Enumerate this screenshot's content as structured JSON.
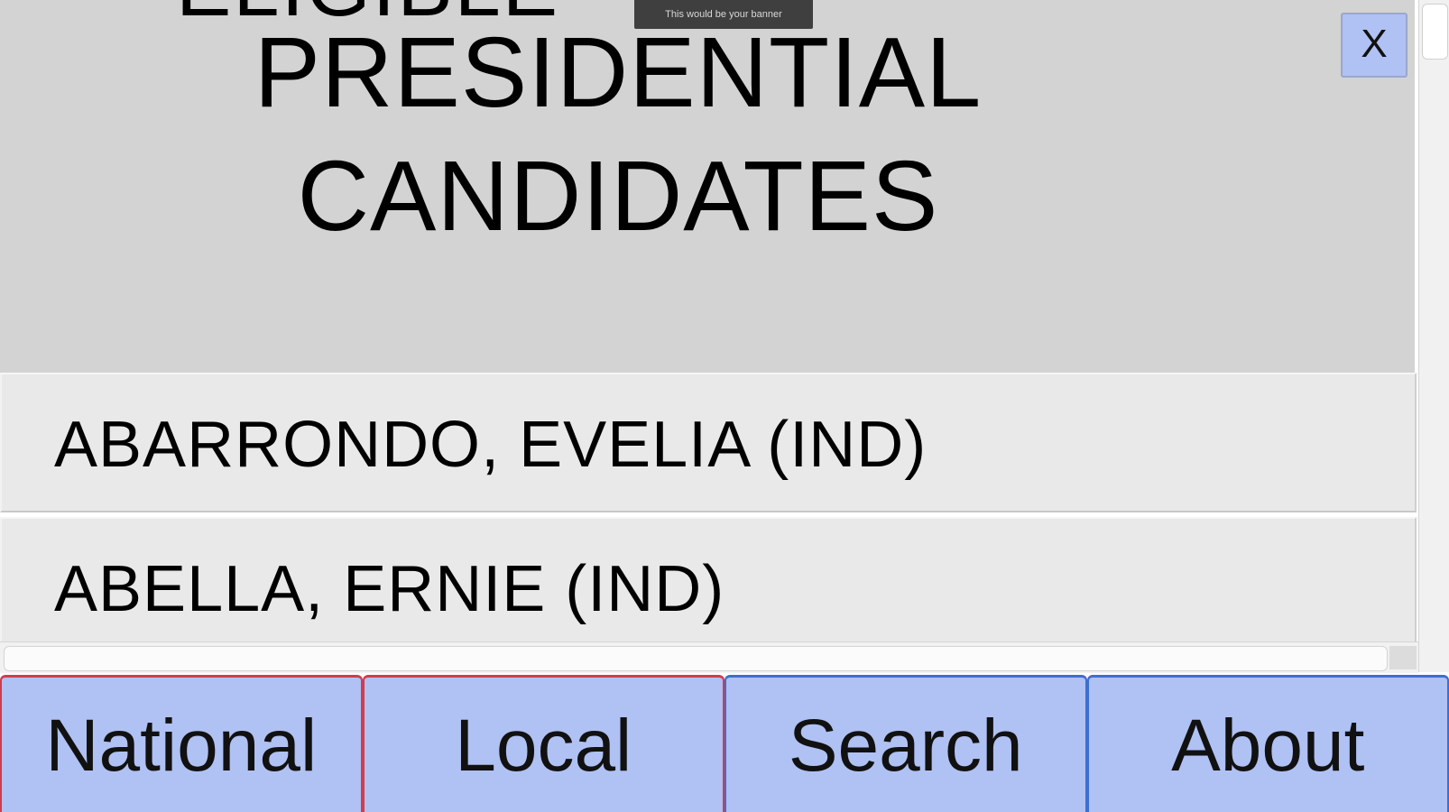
{
  "header": {
    "cut_heading": "ELIGIBLE",
    "title_line1": "PRESIDENTIAL",
    "title_line2": "CANDIDATES",
    "banner_text": "This would be your banner",
    "close_label": "X"
  },
  "candidates": [
    {
      "name": "ABARRONDO, EVELIA (IND)"
    },
    {
      "name": "ABELLA, ERNIE (IND)"
    }
  ],
  "nav": {
    "items": [
      {
        "label": "National"
      },
      {
        "label": "Local"
      },
      {
        "label": "Search"
      },
      {
        "label": "About"
      }
    ]
  },
  "colors": {
    "header_bg": "#d3d3d3",
    "list_item_bg": "#e9e9e9",
    "button_bg": "#b0c1f3",
    "red_border": "#d13c4e",
    "blue_border": "#3d6fcf"
  }
}
